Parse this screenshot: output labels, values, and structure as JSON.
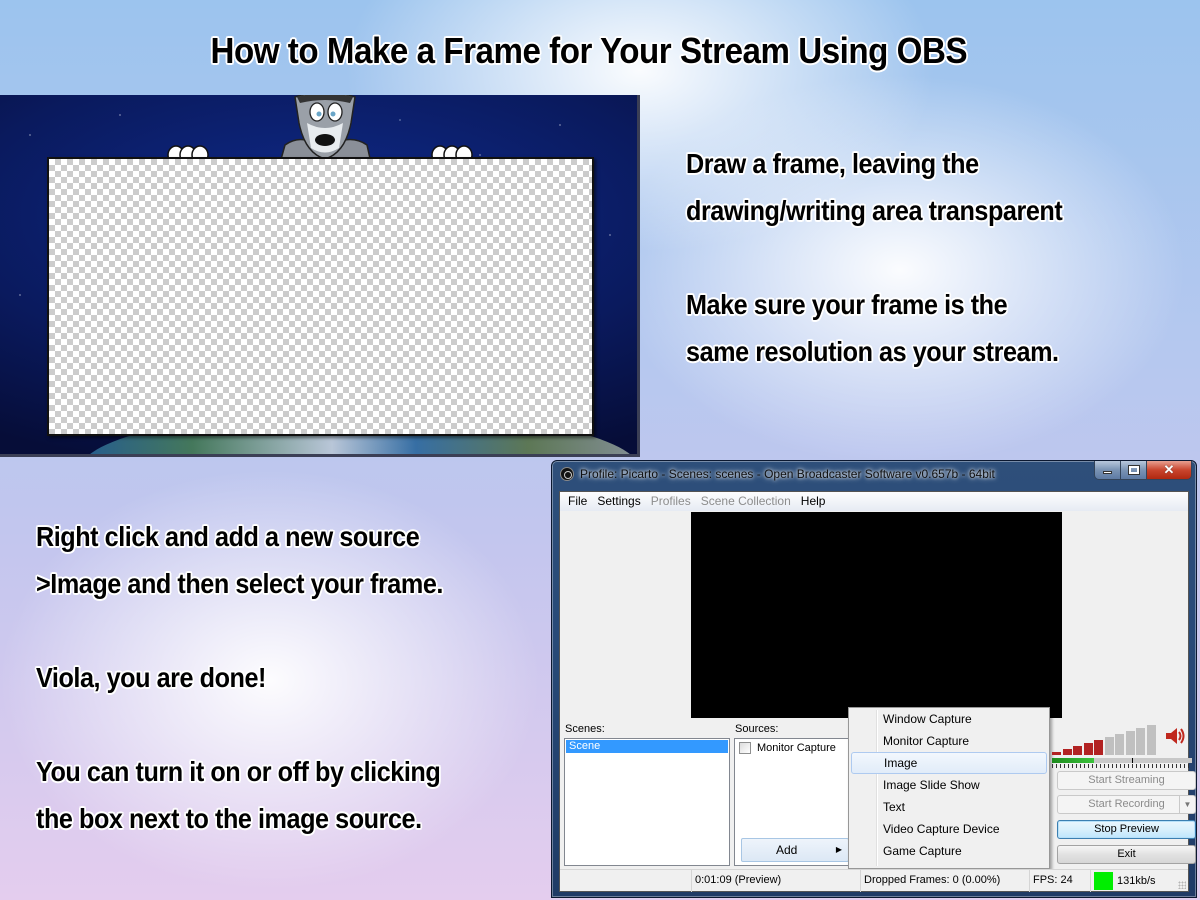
{
  "title": "How to Make a Frame for Your Stream Using OBS",
  "instructions_top": {
    "lines": [
      "Draw a frame, leaving the",
      "drawing/writing area transparent",
      "",
      "Make sure your frame is the",
      "same resolution as your stream."
    ]
  },
  "instructions_bottom": {
    "lines": [
      "Right click and add a new source",
      ">Image and then select your frame.",
      "",
      "Viola, you are done!",
      "",
      "You can turn it on or off by clicking",
      "the box next to the image source."
    ]
  },
  "frame_preview": {
    "description": "Space background with wolf character holding a transparent sign"
  },
  "obs": {
    "window_title": "Profile: Picarto - Scenes: scenes - Open Broadcaster Software v0.657b - 64bit",
    "window_buttons": {
      "minimize": "minimize-icon",
      "maximize": "maximize-icon",
      "close": "close-icon"
    },
    "menu": [
      {
        "label": "File",
        "enabled": true
      },
      {
        "label": "Settings",
        "enabled": true
      },
      {
        "label": "Profiles",
        "enabled": false
      },
      {
        "label": "Scene Collection",
        "enabled": false
      },
      {
        "label": "Help",
        "enabled": true
      }
    ],
    "scenes_label": "Scenes:",
    "scenes": [
      {
        "label": "Scene",
        "selected": true
      }
    ],
    "sources_label": "Sources:",
    "sources": [
      {
        "label": "Monitor Capture",
        "checked": false
      }
    ],
    "add_button": "Add",
    "context_menu": [
      {
        "label": "Window Capture",
        "highlighted": false
      },
      {
        "label": "Monitor Capture",
        "highlighted": false
      },
      {
        "label": "Image",
        "highlighted": true
      },
      {
        "label": "Image Slide Show",
        "highlighted": false
      },
      {
        "label": "Text",
        "highlighted": false
      },
      {
        "label": "Video Capture Device",
        "highlighted": false
      },
      {
        "label": "Game Capture",
        "highlighted": false
      }
    ],
    "volume": {
      "bars_active": 5,
      "bars_total": 10,
      "level_fraction": 0.3,
      "active_color": "#b22222",
      "inactive_color": "#c0c0c0"
    },
    "buttons": {
      "start_streaming": "Start Streaming",
      "start_recording": "Start Recording",
      "stop_preview": "Stop Preview",
      "exit": "Exit"
    },
    "status": {
      "time": "0:01:09 (Preview)",
      "dropped_frames": "Dropped Frames: 0 (0.00%)",
      "fps": "FPS: 24",
      "bitrate": "131kb/s",
      "bitrate_indicator_color": "#00ee00"
    }
  }
}
